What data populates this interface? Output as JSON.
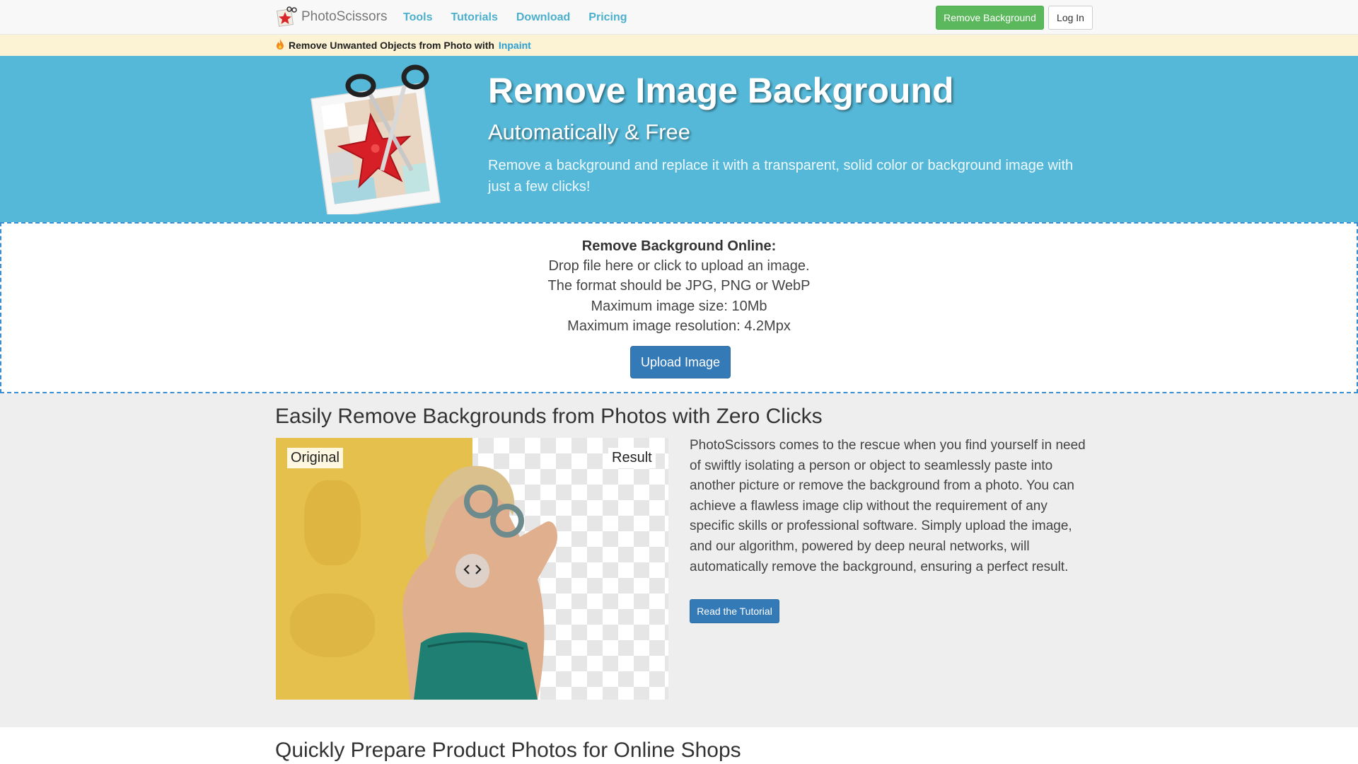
{
  "navbar": {
    "brand": "PhotoScissors",
    "links": [
      "Tools",
      "Tutorials",
      "Download",
      "Pricing"
    ],
    "cta_label": "Remove Background",
    "login_label": "Log In"
  },
  "announce": {
    "icon": "fire-icon",
    "text": "Remove Unwanted Objects from Photo with",
    "link": "Inpaint"
  },
  "hero": {
    "title": "Remove Image Background",
    "subtitle": "Automatically & Free",
    "description": "Remove a background and replace it with a transparent, solid color or background image with just a few clicks!"
  },
  "upload": {
    "title": "Remove Background Online:",
    "lines": [
      "Drop file here or click to upload an image.",
      "The format should be JPG, PNG or WebP",
      "Maximum image size: 10Mb",
      "Maximum image resolution: 4.2Mpx"
    ],
    "button_label": "Upload Image"
  },
  "section": {
    "title": "Easily Remove Backgrounds from Photos with Zero Clicks",
    "label_original": "Original",
    "label_result": "Result",
    "text": "PhotoScissors comes to the rescue when you find yourself in need of swiftly isolating a person or object to seamlessly paste into another picture or remove the background from a photo. You can achieve a flawless image clip without the requirement of any specific skills or professional software. Simply upload the image, and our algorithm, powered by deep neural networks, will automatically remove the background, ensuring a perfect result.",
    "button_label": "Read the Tutorial"
  },
  "section2": {
    "title": "Quickly Prepare Product Photos for Online Shops"
  },
  "colors": {
    "hero_bg": "#55b8d8",
    "nav_link": "#4cb0cc",
    "green_button": "#5cb85c",
    "primary_button": "#337ab7",
    "announce_bg": "#fcf3d4"
  }
}
